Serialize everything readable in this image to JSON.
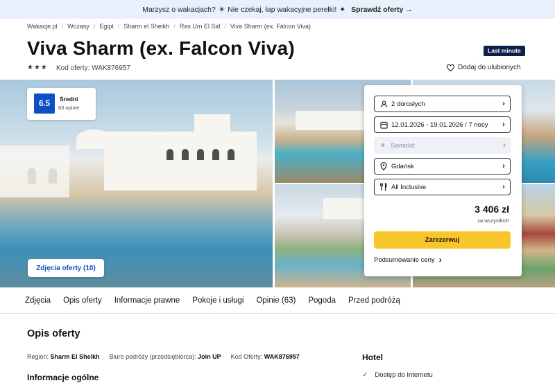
{
  "promo": {
    "text": "Marzysz o wakacjach?",
    "text2": "Nie czekaj, łap wakacyjne perełki!",
    "link": "Sprawdź oferty →"
  },
  "breadcrumbs": [
    "Wakacje.pl",
    "Wczasy",
    "Egipt",
    "Sharm el Sheikh",
    "Ras Um El Sid",
    "Viva Sharm (ex. Falcon Viva)"
  ],
  "header": {
    "title": "Viva Sharm (ex. Falcon Viva)",
    "badge": "Last minute",
    "stars": "★★★",
    "code": "Kod oferty: WAK876957",
    "favorite": "Dodaj do ulubionych"
  },
  "rating": {
    "score": "6.5",
    "label": "Średni",
    "reviews": "63 opinie"
  },
  "gallery": {
    "photos_button": "Zdjęcia oferty (10)"
  },
  "booking": {
    "travelers": "2 dorosłych",
    "dates": "12.01.2026 - 19.01.2026 / 7 nocy",
    "transport": "Samolot",
    "departure": "Gdańsk",
    "board": "All Inclusive",
    "price": "3 406 zł",
    "price_note": "za wszystkich",
    "book_button": "Zarezerwuj",
    "summary_link": "Podsumowanie ceny"
  },
  "tabs": [
    "Zdjęcia",
    "Opis oferty",
    "Informacje prawne",
    "Pokoje i usługi",
    "Opinie (63)",
    "Pogoda",
    "Przed podróżą"
  ],
  "description": {
    "heading": "Opis oferty",
    "region_label": "Region:",
    "region": "Sharm El Sheikh",
    "operator_label": "Biuro podróży (przedsiębiorca):",
    "operator": "Join UP",
    "code_label": "Kod Oferty:",
    "code": "WAK876957",
    "subheading": "Informacje ogólne"
  },
  "hotel": {
    "heading": "Hotel",
    "feature": "Dostęp do Internetu"
  }
}
